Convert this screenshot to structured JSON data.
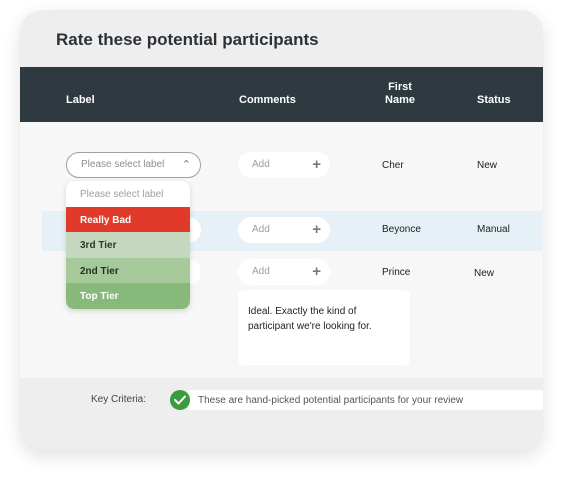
{
  "title": "Rate these potential participants",
  "columns": {
    "label": "Label",
    "comments": "Comments",
    "first_name": "First Name",
    "status": "Status"
  },
  "label_select": {
    "placeholder": "Please select label",
    "options": [
      "Please select label",
      "Really Bad",
      "3rd Tier",
      "2nd Tier",
      "Top Tier"
    ]
  },
  "rows": [
    {
      "comment_placeholder": "Add",
      "first_name": "Cher",
      "status": "New"
    },
    {
      "comment_placeholder": "Add",
      "first_name": "Beyonce",
      "status": "Manual"
    },
    {
      "comment_placeholder": "Add",
      "first_name": "Prince",
      "status": "New"
    }
  ],
  "comment_text": "Ideal. Exactly the kind of participant we're looking for.",
  "key_criteria": {
    "label": "Key Criteria:",
    "text": "These are hand-picked potential participants for your review"
  },
  "colors": {
    "header": "#2e3a40",
    "really_bad": "#e23a2a",
    "tier3": "#c3d8bd",
    "tier2": "#a5c99b",
    "top_tier": "#86b97a",
    "check": "#3a9b3e"
  },
  "icons": [
    "chevron-up-icon",
    "plus-icon",
    "check-icon"
  ]
}
